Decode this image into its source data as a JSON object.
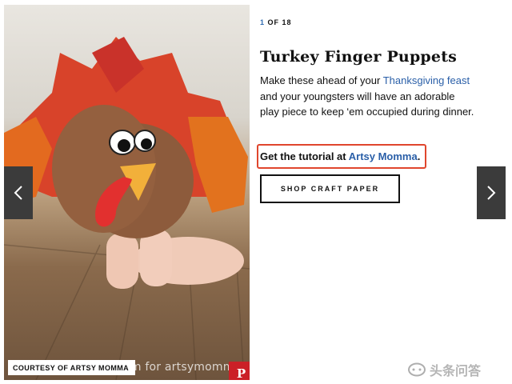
{
  "slide": {
    "current": "1",
    "separator": "OF",
    "total": "18"
  },
  "article": {
    "title": "Turkey Finger Puppets",
    "desc_part1": "Make these ahead of your ",
    "desc_link": "Thanksgiving feast",
    "desc_part2": " and your youngsters will have an adorable play piece to keep ‘em occupied during dinner.",
    "tutorial_prefix": "Get the tutorial at ",
    "tutorial_link": "Artsy Momma",
    "tutorial_suffix": ".",
    "shop_button": "SHOP CRAFT PAPER"
  },
  "photo": {
    "watermark": "iheartcraftythings.com for artsymomma",
    "credit": "COURTESY OF ARTSY MOMMA",
    "pin_label": "P"
  },
  "brand": {
    "text": "头条问答"
  },
  "icons": {
    "prev": "chevron-left-icon",
    "next": "chevron-right-icon",
    "pin": "pinterest-icon",
    "brand": "brand-logo-icon"
  },
  "colors": {
    "accent_link": "#2a5fa8",
    "highlight": "#e0462d",
    "pinterest": "#cb2027",
    "nav_bg": "#3b3b3b"
  }
}
